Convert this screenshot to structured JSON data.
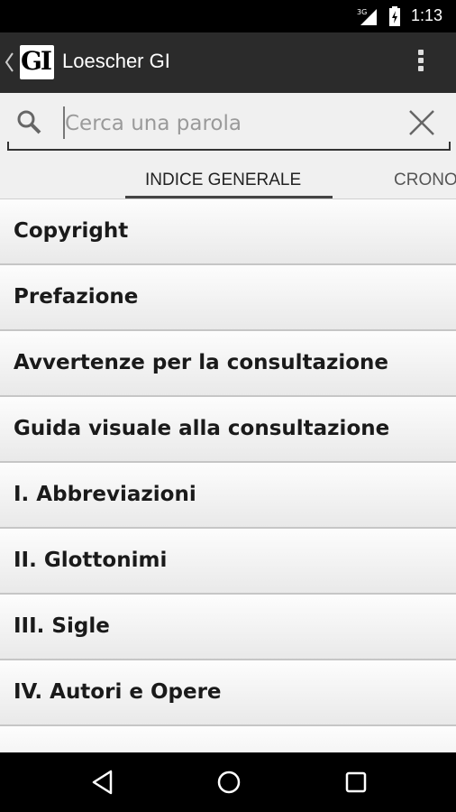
{
  "status_bar": {
    "network": "3G",
    "time": "1:13"
  },
  "action_bar": {
    "logo_text": "GI",
    "title": "Loescher GI"
  },
  "search": {
    "placeholder": "Cerca una parola",
    "value": ""
  },
  "tabs": [
    {
      "label": "INDICE GENERALE",
      "active": true
    },
    {
      "label": "CRONOLOGIA",
      "active": false
    }
  ],
  "list": {
    "items": [
      {
        "label": "Copyright"
      },
      {
        "label": "Prefazione"
      },
      {
        "label": "Avvertenze per la consultazione"
      },
      {
        "label": "Guida visuale alla consultazione"
      },
      {
        "label": "I. Abbreviazioni"
      },
      {
        "label": "II. Glottonimi"
      },
      {
        "label": "III. Sigle"
      },
      {
        "label": "IV. Autori e Opere"
      },
      {
        "label": ""
      }
    ]
  },
  "colors": {
    "action_bar": "#2b2b2b",
    "background": "#f0f0f0",
    "status_bar": "#000000"
  }
}
